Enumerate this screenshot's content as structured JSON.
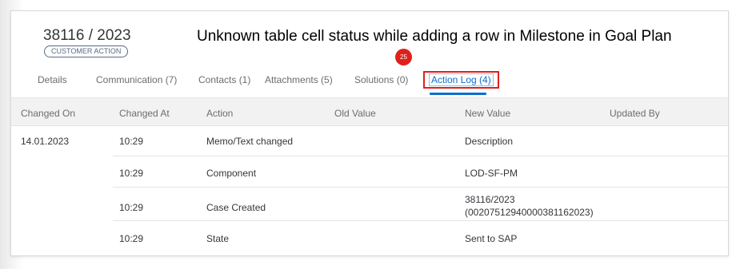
{
  "header": {
    "case_id": "38116 / 2023",
    "badge": "CUSTOMER ACTION",
    "title": "Unknown table cell status while adding a row in Milestone in Goal Plan",
    "step_number": "25"
  },
  "tabs": [
    {
      "label": "Details"
    },
    {
      "label": "Communication (7)"
    },
    {
      "label": "Contacts (1)"
    },
    {
      "label": "Attachments (5)"
    },
    {
      "label": "Solutions (0)"
    },
    {
      "label": "Action Log (4)",
      "active": true
    }
  ],
  "table": {
    "columns": [
      "Changed On",
      "Changed At",
      "Action",
      "Old Value",
      "New Value",
      "Updated By"
    ],
    "rows": [
      {
        "changed_on": "14.01.2023",
        "changed_at": "10:29",
        "action": "Memo/Text changed",
        "old_value": "",
        "new_value": "Description",
        "new_value_2": "",
        "updated_by": ""
      },
      {
        "changed_on": "",
        "changed_at": "10:29",
        "action": "Component",
        "old_value": "",
        "new_value": "LOD-SF-PM",
        "new_value_2": "",
        "updated_by": ""
      },
      {
        "changed_on": "",
        "changed_at": "10:29",
        "action": "Case Created",
        "old_value": "",
        "new_value": "38116/2023",
        "new_value_2": "(0020751294000038116​2023)",
        "updated_by": ""
      },
      {
        "changed_on": "",
        "changed_at": "10:29",
        "action": "State",
        "old_value": "",
        "new_value": "Sent to SAP",
        "new_value_2": "",
        "updated_by": ""
      }
    ]
  }
}
